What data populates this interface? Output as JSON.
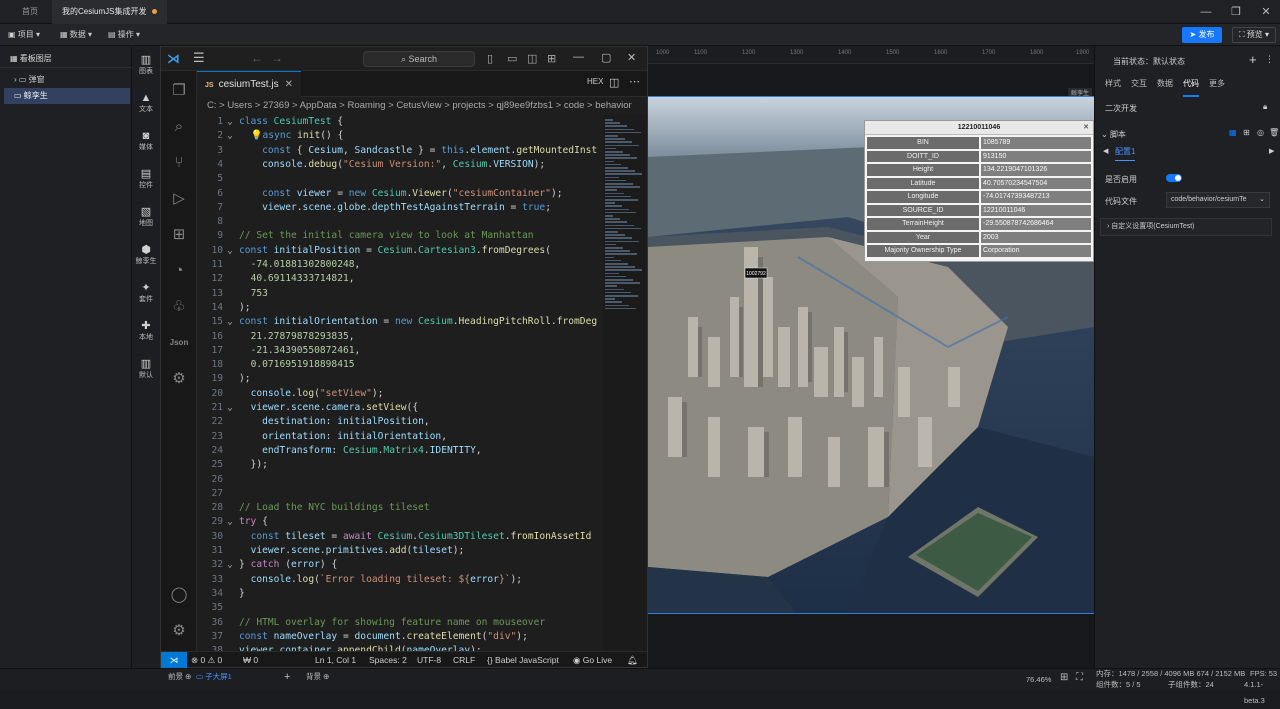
{
  "tabs": [
    {
      "label": "首页"
    },
    {
      "label": "我的CesiumJS集成开发"
    }
  ],
  "toolbar": {
    "project": "项目",
    "data": "数据",
    "operate": "操作",
    "publish": "发布",
    "preview": "预览"
  },
  "layers": {
    "header": "看板图层",
    "items": [
      "弹窗",
      "鲸孪生"
    ]
  },
  "rail": [
    "图表",
    "文本",
    "媒体",
    "控件",
    "地图",
    "鲸孪生",
    "套件",
    "本地",
    "默认"
  ],
  "vscode": {
    "search": "Search",
    "tab_label": "cesiumTest.js",
    "hex": "HEX",
    "breadcrumb": "C: > Users > 27369 > AppData > Roaming > CetusView > projects > qj89ee9fzbs1 > code > behavior",
    "status": {
      "errors": "⊗ 0 ⚠ 0",
      "ports": "₩ 0",
      "position": "Ln 1, Col 1",
      "spaces": "Spaces: 2",
      "encoding": "UTF-8",
      "eol": "CRLF",
      "language": "Babel JavaScript",
      "golive": "Go Live"
    }
  },
  "canvas": {
    "ruler": [
      "1000",
      "1100",
      "1200",
      "1300",
      "1400",
      "1500",
      "1600",
      "1700",
      "1800",
      "1900"
    ],
    "label_tag": "鲸孪生",
    "pin": "1002792",
    "info_title": "12210011046",
    "info_rows": [
      {
        "k": "BIN",
        "v": "1085789"
      },
      {
        "k": "DOITT_ID",
        "v": "913150"
      },
      {
        "k": "Height",
        "v": "134.2219047101326"
      },
      {
        "k": "Latitude",
        "v": "40.70570234547504"
      },
      {
        "k": "Longitude",
        "v": "-74.01747393487213"
      },
      {
        "k": "SOURCE_ID",
        "v": "12210011046"
      },
      {
        "k": "TerrainHeight",
        "v": "-29.550878742686464"
      },
      {
        "k": "Year",
        "v": "2003"
      },
      {
        "k": "Majority Ownership Type",
        "v": "Corporation"
      }
    ]
  },
  "props": {
    "state": "当前状态：默认状态",
    "tabs": [
      "样式",
      "交互",
      "数据",
      "代码",
      "更多"
    ],
    "section": "二次开发",
    "script": "脚本",
    "config": "配置1",
    "enable": "是否启用",
    "code_file": "代码文件",
    "code_file_value": "code/behavior/cesiumTe",
    "custom": "自定义设置项(CesiumTest)"
  },
  "bottom": {
    "front": "前景",
    "sub": "子大屏1",
    "back": "背景",
    "zoom": "76.46%",
    "mem": "内存：1478 / 2558 / 4096 MB  674 / 2152 MB",
    "fps": "FPS: 53",
    "groups": "组件数：5 / 5",
    "children": "子组件数：24",
    "version": "4.1.1-beta.3"
  },
  "code": [
    [
      [
        "k",
        "class "
      ],
      [
        "t",
        "CesiumTest "
      ],
      [
        "p",
        "{"
      ]
    ],
    [
      [
        "p",
        "  💡"
      ],
      [
        "k",
        "async "
      ],
      [
        "f",
        "init"
      ],
      [
        "p",
        "() {"
      ]
    ],
    [
      [
        "p",
        "    "
      ],
      [
        "k",
        "const "
      ],
      [
        "p",
        "{ "
      ],
      [
        "v",
        "Cesium"
      ],
      [
        "p",
        ", "
      ],
      [
        "v",
        "Sandcastle"
      ],
      [
        "p",
        " } = "
      ],
      [
        "k",
        "this"
      ],
      [
        "p",
        "."
      ],
      [
        "v",
        "element"
      ],
      [
        "p",
        "."
      ],
      [
        "f",
        "getMountedInst"
      ]
    ],
    [
      [
        "p",
        "    "
      ],
      [
        "v",
        "console"
      ],
      [
        "p",
        "."
      ],
      [
        "f",
        "debug"
      ],
      [
        "p",
        "("
      ],
      [
        "s",
        "\"Cesium Version:\""
      ],
      [
        "p",
        ", "
      ],
      [
        "t",
        "Cesium"
      ],
      [
        "p",
        "."
      ],
      [
        "v",
        "VERSION"
      ],
      [
        "p",
        ");"
      ]
    ],
    [
      [
        "p",
        ""
      ]
    ],
    [
      [
        "p",
        "    "
      ],
      [
        "k",
        "const "
      ],
      [
        "v",
        "viewer"
      ],
      [
        "p",
        " = "
      ],
      [
        "k",
        "new "
      ],
      [
        "t",
        "Cesium"
      ],
      [
        "p",
        "."
      ],
      [
        "f",
        "Viewer"
      ],
      [
        "p",
        "("
      ],
      [
        "s",
        "\"cesiumContainer\""
      ],
      [
        "p",
        ");"
      ]
    ],
    [
      [
        "p",
        "    "
      ],
      [
        "v",
        "viewer"
      ],
      [
        "p",
        "."
      ],
      [
        "v",
        "scene"
      ],
      [
        "p",
        "."
      ],
      [
        "v",
        "globe"
      ],
      [
        "p",
        "."
      ],
      [
        "v",
        "depthTestAgainstTerrain"
      ],
      [
        "p",
        " = "
      ],
      [
        "k",
        "true"
      ],
      [
        "p",
        ";"
      ]
    ],
    [
      [
        "p",
        ""
      ]
    ],
    [
      [
        "cm",
        "// Set the initial camera view to look at Manhattan"
      ]
    ],
    [
      [
        "k",
        "const "
      ],
      [
        "v",
        "initialPosition"
      ],
      [
        "p",
        " = "
      ],
      [
        "t",
        "Cesium"
      ],
      [
        "p",
        "."
      ],
      [
        "t",
        "Cartesian3"
      ],
      [
        "p",
        "."
      ],
      [
        "f",
        "fromDegrees"
      ],
      [
        "p",
        "("
      ]
    ],
    [
      [
        "p",
        "  "
      ],
      [
        "n",
        "-74.01881302800248"
      ],
      [
        "p",
        ","
      ]
    ],
    [
      [
        "p",
        "  "
      ],
      [
        "n",
        "40.69114333714821"
      ],
      [
        "p",
        ","
      ]
    ],
    [
      [
        "p",
        "  "
      ],
      [
        "n",
        "753"
      ]
    ],
    [
      [
        "p",
        ");"
      ]
    ],
    [
      [
        "k",
        "const "
      ],
      [
        "v",
        "initialOrientation"
      ],
      [
        "p",
        " = "
      ],
      [
        "k",
        "new "
      ],
      [
        "t",
        "Cesium"
      ],
      [
        "p",
        "."
      ],
      [
        "f",
        "HeadingPitchRoll"
      ],
      [
        "p",
        "."
      ],
      [
        "f",
        "fromDeg"
      ]
    ],
    [
      [
        "p",
        "  "
      ],
      [
        "n",
        "21.27879878293835"
      ],
      [
        "p",
        ","
      ]
    ],
    [
      [
        "p",
        "  "
      ],
      [
        "n",
        "-21.34390550872461"
      ],
      [
        "p",
        ","
      ]
    ],
    [
      [
        "p",
        "  "
      ],
      [
        "n",
        "0.0716951918898415"
      ]
    ],
    [
      [
        "p",
        ");"
      ]
    ],
    [
      [
        "p",
        "  "
      ],
      [
        "v",
        "console"
      ],
      [
        "p",
        "."
      ],
      [
        "f",
        "log"
      ],
      [
        "p",
        "("
      ],
      [
        "s",
        "\"setView\""
      ],
      [
        "p",
        ");"
      ]
    ],
    [
      [
        "p",
        "  "
      ],
      [
        "v",
        "viewer"
      ],
      [
        "p",
        "."
      ],
      [
        "v",
        "scene"
      ],
      [
        "p",
        "."
      ],
      [
        "v",
        "camera"
      ],
      [
        "p",
        "."
      ],
      [
        "f",
        "setView"
      ],
      [
        "p",
        "({"
      ]
    ],
    [
      [
        "p",
        "    "
      ],
      [
        "v",
        "destination"
      ],
      [
        "p",
        ": "
      ],
      [
        "v",
        "initialPosition"
      ],
      [
        "p",
        ","
      ]
    ],
    [
      [
        "p",
        "    "
      ],
      [
        "v",
        "orientation"
      ],
      [
        "p",
        ": "
      ],
      [
        "v",
        "initialOrientation"
      ],
      [
        "p",
        ","
      ]
    ],
    [
      [
        "p",
        "    "
      ],
      [
        "v",
        "endTransform"
      ],
      [
        "p",
        ": "
      ],
      [
        "t",
        "Cesium"
      ],
      [
        "p",
        "."
      ],
      [
        "t",
        "Matrix4"
      ],
      [
        "p",
        "."
      ],
      [
        "v",
        "IDENTITY"
      ],
      [
        "p",
        ","
      ]
    ],
    [
      [
        "p",
        "  });"
      ]
    ],
    [
      [
        "p",
        ""
      ]
    ],
    [
      [
        "p",
        ""
      ]
    ],
    [
      [
        "cm",
        "// Load the NYC buildings tileset"
      ]
    ],
    [
      [
        "c2",
        "try "
      ],
      [
        "p",
        "{"
      ]
    ],
    [
      [
        "p",
        "  "
      ],
      [
        "k",
        "const "
      ],
      [
        "v",
        "tileset"
      ],
      [
        "p",
        " = "
      ],
      [
        "c2",
        "await "
      ],
      [
        "t",
        "Cesium"
      ],
      [
        "p",
        "."
      ],
      [
        "t",
        "Cesium3DTileset"
      ],
      [
        "p",
        "."
      ],
      [
        "f",
        "fromIonAssetId"
      ]
    ],
    [
      [
        "p",
        "  "
      ],
      [
        "v",
        "viewer"
      ],
      [
        "p",
        "."
      ],
      [
        "v",
        "scene"
      ],
      [
        "p",
        "."
      ],
      [
        "v",
        "primitives"
      ],
      [
        "p",
        "."
      ],
      [
        "f",
        "add"
      ],
      [
        "p",
        "("
      ],
      [
        "v",
        "tileset"
      ],
      [
        "p",
        ");"
      ]
    ],
    [
      [
        "p",
        "} "
      ],
      [
        "c2",
        "catch "
      ],
      [
        "p",
        "("
      ],
      [
        "v",
        "error"
      ],
      [
        "p",
        ") {"
      ]
    ],
    [
      [
        "p",
        "  "
      ],
      [
        "v",
        "console"
      ],
      [
        "p",
        "."
      ],
      [
        "f",
        "log"
      ],
      [
        "p",
        "("
      ],
      [
        "s",
        "`Error loading tileset: ${"
      ],
      [
        "v",
        "error"
      ],
      [
        "s",
        "}`"
      ],
      [
        "p",
        ");"
      ]
    ],
    [
      [
        "p",
        "}"
      ]
    ],
    [
      [
        "p",
        ""
      ]
    ],
    [
      [
        "cm",
        "// HTML overlay for showing feature name on mouseover"
      ]
    ],
    [
      [
        "k",
        "const "
      ],
      [
        "v",
        "nameOverlay"
      ],
      [
        "p",
        " = "
      ],
      [
        "v",
        "document"
      ],
      [
        "p",
        "."
      ],
      [
        "f",
        "createElement"
      ],
      [
        "p",
        "("
      ],
      [
        "s",
        "\"div\""
      ],
      [
        "p",
        ");"
      ]
    ],
    [
      [
        "v",
        "viewer"
      ],
      [
        "p",
        "."
      ],
      [
        "v",
        "container"
      ],
      [
        "p",
        "."
      ],
      [
        "f",
        "appendChild"
      ],
      [
        "p",
        "("
      ],
      [
        "v",
        "nameOverlay"
      ],
      [
        "p",
        ");"
      ]
    ]
  ]
}
